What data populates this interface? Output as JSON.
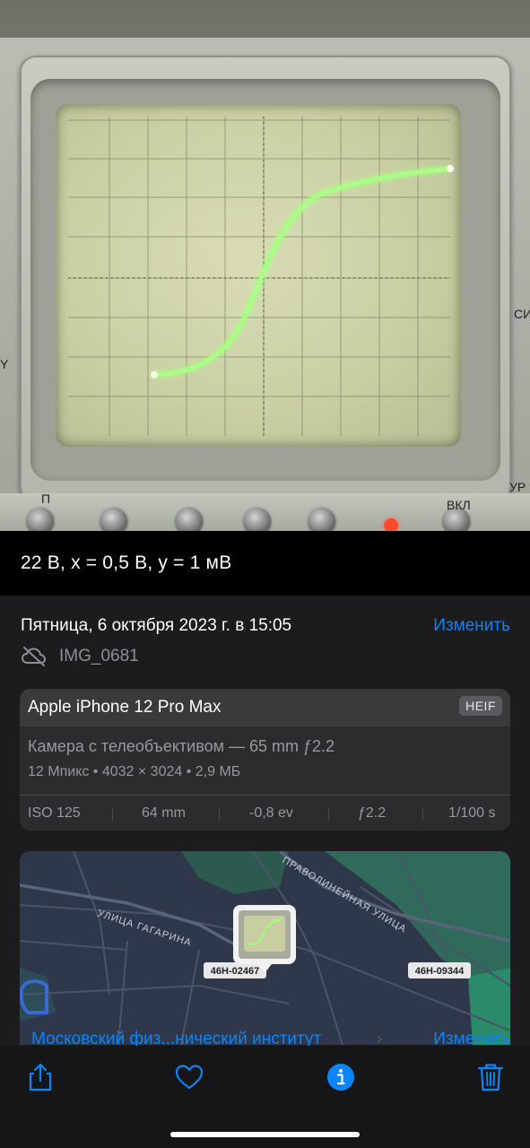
{
  "caption": "22 В, x = 0,5 В, y = 1 мВ",
  "date_time": "Пятница, 6 октября 2023 г. в 15:05",
  "edit_label": "Изменить",
  "filename": "IMG_0681",
  "device": {
    "name": "Apple iPhone 12 Pro Max",
    "format": "HEIF",
    "lens": "Камера с телеобъективом — 65 mm ƒ2.2",
    "specs": "12 Мпикс • 4032 × 3024 • 2,9 МБ"
  },
  "exif": {
    "iso": "ISO 125",
    "focal": "64 mm",
    "exposure": "-0,8 ev",
    "aperture": "ƒ2.2",
    "shutter": "1/100 s"
  },
  "map": {
    "street_1": "УЛИЦА ГАГАРИНА",
    "street_2": "ПРАВОЛИНЕЙНАЯ УЛИЦА",
    "marker_1": "46Н-02467",
    "marker_2": "46Н-09344",
    "location": "Московский физ...нический институт",
    "edit_label": "Изменить"
  },
  "panel_labels": {
    "vkl": "ВКЛ",
    "p": "П",
    "si": "СИ",
    "ur": "УР",
    "y": "Y"
  },
  "colors": {
    "accent": "#0a84ff",
    "background": "#1c1c1e",
    "card": "#2c2c2e",
    "trace": "#9cff7a"
  }
}
